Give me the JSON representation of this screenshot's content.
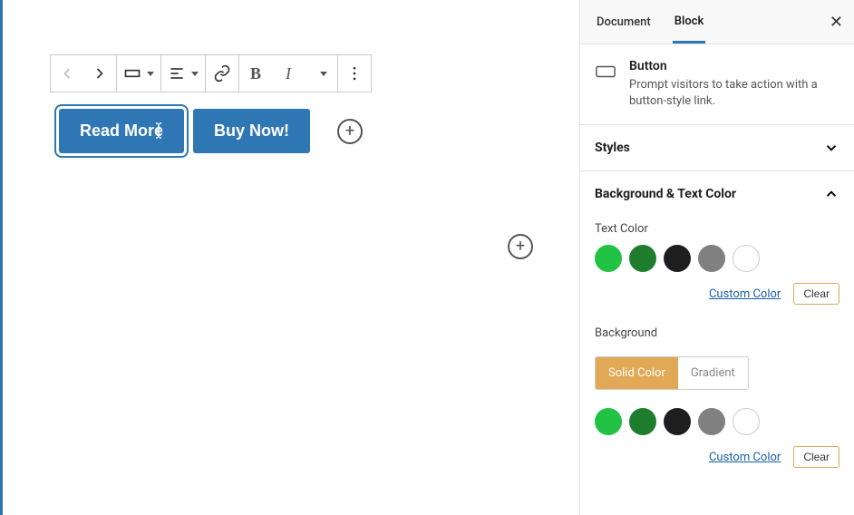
{
  "sidebar": {
    "tabs": {
      "document": "Document",
      "block": "Block"
    },
    "block": {
      "title": "Button",
      "desc": "Prompt visitors to take action with a button-style link."
    },
    "panels": {
      "styles": "Styles",
      "bgtext": "Background & Text Color"
    },
    "textcolor_label": "Text Color",
    "background_label": "Background",
    "seg": {
      "solid": "Solid Color",
      "gradient": "Gradient"
    },
    "custom": "Custom Color",
    "clear": "Clear",
    "swatches": [
      "#22C245",
      "#1E7E2E",
      "#1E1E1E",
      "#808080"
    ]
  },
  "editor": {
    "buttons": [
      "Read More",
      "Buy Now!"
    ]
  }
}
